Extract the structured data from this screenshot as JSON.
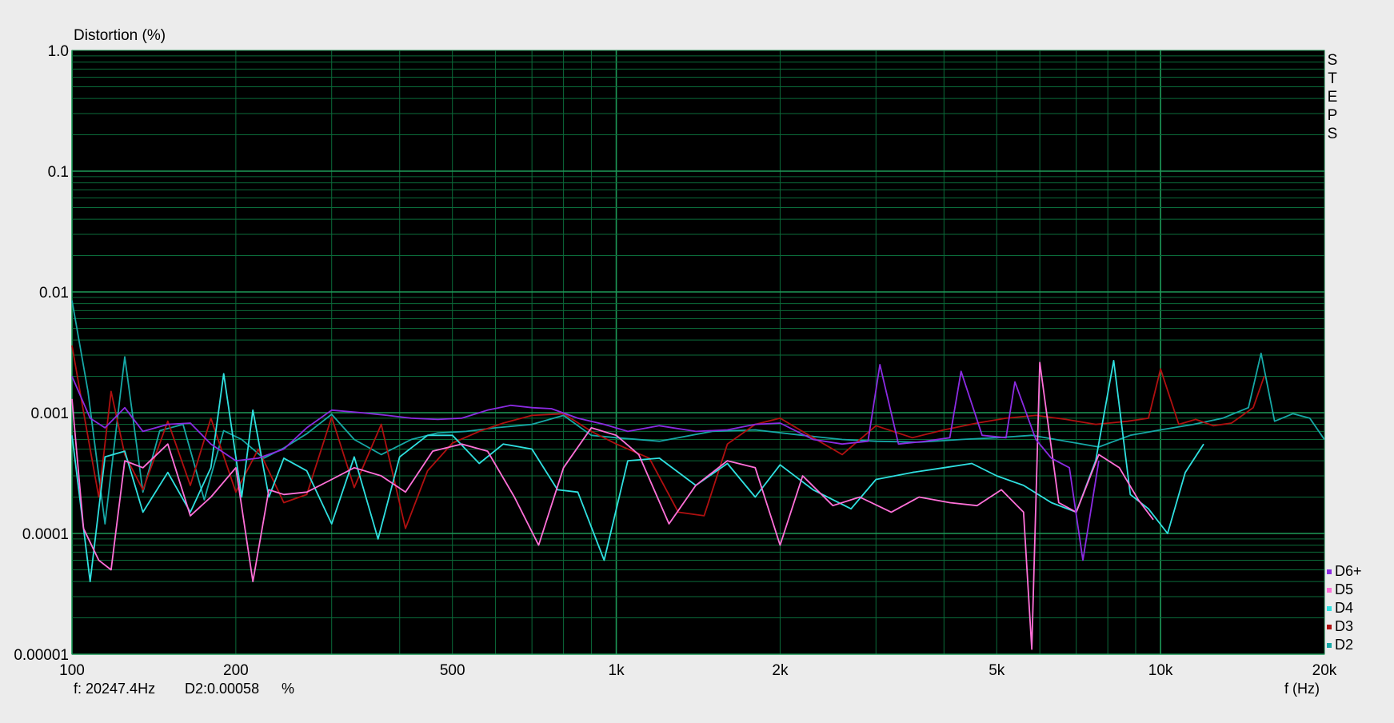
{
  "chart_data": {
    "type": "line",
    "ylabel": "Distortion (%)",
    "xlabel": "f (Hz)",
    "side_label": "STEPS",
    "xscale": "log",
    "yscale": "log",
    "xlim": [
      100,
      20000
    ],
    "ylim": [
      1e-05,
      1.0
    ],
    "grid": true,
    "legend_position": "bottom-right",
    "background": "#000000",
    "grid_color": "#0b6b3a",
    "x_ticks": [
      {
        "value": 100,
        "label": "100"
      },
      {
        "value": 200,
        "label": "200"
      },
      {
        "value": 500,
        "label": "500"
      },
      {
        "value": 1000,
        "label": "1k"
      },
      {
        "value": 2000,
        "label": "2k"
      },
      {
        "value": 5000,
        "label": "5k"
      },
      {
        "value": 10000,
        "label": "10k"
      },
      {
        "value": 20000,
        "label": "20k"
      }
    ],
    "y_ticks": [
      {
        "value": 1.0,
        "label": "1.0"
      },
      {
        "value": 0.1,
        "label": "0.1"
      },
      {
        "value": 0.01,
        "label": "0.01"
      },
      {
        "value": 0.001,
        "label": "0.001"
      },
      {
        "value": 0.0001,
        "label": "0.0001"
      },
      {
        "value": 1e-05,
        "label": "0.00001"
      }
    ],
    "series": [
      {
        "name": "D2",
        "color": "#16a8a6",
        "points": [
          [
            100,
            0.0085
          ],
          [
            107,
            0.0015
          ],
          [
            115,
            0.00012
          ],
          [
            125,
            0.0029
          ],
          [
            135,
            0.00022
          ],
          [
            145,
            0.00071
          ],
          [
            160,
            0.0008
          ],
          [
            175,
            0.00019
          ],
          [
            190,
            0.00071
          ],
          [
            205,
            0.0006
          ],
          [
            225,
            0.00042
          ],
          [
            245,
            0.00051
          ],
          [
            270,
            0.00067
          ],
          [
            300,
            0.00097
          ],
          [
            330,
            0.0006
          ],
          [
            370,
            0.00045
          ],
          [
            420,
            0.0006
          ],
          [
            470,
            0.00068
          ],
          [
            530,
            0.0007
          ],
          [
            600,
            0.00075
          ],
          [
            700,
            0.0008
          ],
          [
            800,
            0.00095
          ],
          [
            900,
            0.00065
          ],
          [
            1000,
            0.00062
          ],
          [
            1200,
            0.00058
          ],
          [
            1500,
            0.0007
          ],
          [
            1800,
            0.00072
          ],
          [
            2200,
            0.00065
          ],
          [
            2600,
            0.0006
          ],
          [
            3000,
            0.00058
          ],
          [
            3600,
            0.00057
          ],
          [
            4300,
            0.0006
          ],
          [
            5000,
            0.00062
          ],
          [
            5800,
            0.00065
          ],
          [
            6700,
            0.00058
          ],
          [
            7700,
            0.00052
          ],
          [
            8800,
            0.00065
          ],
          [
            10000,
            0.00072
          ],
          [
            11500,
            0.0008
          ],
          [
            13000,
            0.0009
          ],
          [
            14500,
            0.0011
          ],
          [
            15300,
            0.0031
          ],
          [
            16200,
            0.00085
          ],
          [
            17500,
            0.00098
          ],
          [
            18800,
            0.0009
          ],
          [
            20000,
            0.0006
          ]
        ]
      },
      {
        "name": "D3",
        "color": "#b01010",
        "points": [
          [
            100,
            0.0036
          ],
          [
            106,
            0.0008
          ],
          [
            112,
            0.0002
          ],
          [
            118,
            0.0015
          ],
          [
            125,
            0.00045
          ],
          [
            135,
            0.00023
          ],
          [
            150,
            0.00085
          ],
          [
            165,
            0.00025
          ],
          [
            180,
            0.0009
          ],
          [
            200,
            0.00022
          ],
          [
            220,
            0.0005
          ],
          [
            245,
            0.00018
          ],
          [
            270,
            0.00021
          ],
          [
            300,
            0.00092
          ],
          [
            330,
            0.00024
          ],
          [
            370,
            0.0008
          ],
          [
            410,
            0.00011
          ],
          [
            450,
            0.00033
          ],
          [
            500,
            0.00056
          ],
          [
            560,
            0.0007
          ],
          [
            620,
            0.00082
          ],
          [
            700,
            0.00095
          ],
          [
            800,
            0.00098
          ],
          [
            900,
            0.0007
          ],
          [
            1000,
            0.00055
          ],
          [
            1150,
            0.00042
          ],
          [
            1300,
            0.00015
          ],
          [
            1450,
            0.00014
          ],
          [
            1600,
            0.00055
          ],
          [
            1800,
            0.0008
          ],
          [
            2000,
            0.0009
          ],
          [
            2300,
            0.00062
          ],
          [
            2600,
            0.00045
          ],
          [
            3000,
            0.00078
          ],
          [
            3500,
            0.00062
          ],
          [
            4000,
            0.00072
          ],
          [
            4600,
            0.00082
          ],
          [
            5200,
            0.0009
          ],
          [
            5900,
            0.00095
          ],
          [
            6700,
            0.00088
          ],
          [
            7600,
            0.0008
          ],
          [
            8700,
            0.00085
          ],
          [
            9500,
            0.0009
          ],
          [
            10000,
            0.0023
          ],
          [
            10800,
            0.0008
          ],
          [
            11600,
            0.00088
          ],
          [
            12500,
            0.00078
          ],
          [
            13500,
            0.00082
          ],
          [
            14800,
            0.0011
          ],
          [
            15500,
            0.002
          ]
        ]
      },
      {
        "name": "D4",
        "color": "#2fe0e0",
        "points": [
          [
            100,
            0.00065
          ],
          [
            108,
            4e-05
          ],
          [
            115,
            0.00043
          ],
          [
            125,
            0.00048
          ],
          [
            135,
            0.00015
          ],
          [
            150,
            0.00032
          ],
          [
            165,
            0.00015
          ],
          [
            180,
            0.00035
          ],
          [
            190,
            0.0021
          ],
          [
            205,
            0.0002
          ],
          [
            215,
            0.00105
          ],
          [
            230,
            0.0002
          ],
          [
            245,
            0.00042
          ],
          [
            270,
            0.00033
          ],
          [
            300,
            0.00012
          ],
          [
            330,
            0.00043
          ],
          [
            365,
            9e-05
          ],
          [
            400,
            0.00043
          ],
          [
            450,
            0.00065
          ],
          [
            500,
            0.00065
          ],
          [
            560,
            0.00038
          ],
          [
            620,
            0.00055
          ],
          [
            700,
            0.0005
          ],
          [
            780,
            0.00023
          ],
          [
            850,
            0.00022
          ],
          [
            950,
            6e-05
          ],
          [
            1050,
            0.0004
          ],
          [
            1200,
            0.00042
          ],
          [
            1400,
            0.00025
          ],
          [
            1600,
            0.00038
          ],
          [
            1800,
            0.0002
          ],
          [
            2000,
            0.00037
          ],
          [
            2300,
            0.00023
          ],
          [
            2700,
            0.00016
          ],
          [
            3000,
            0.00028
          ],
          [
            3500,
            0.00032
          ],
          [
            4000,
            0.00035
          ],
          [
            4500,
            0.00038
          ],
          [
            5000,
            0.0003
          ],
          [
            5600,
            0.00025
          ],
          [
            6300,
            0.00018
          ],
          [
            7000,
            0.00015
          ],
          [
            7600,
            0.0004
          ],
          [
            8200,
            0.0027
          ],
          [
            8800,
            0.00021
          ],
          [
            9500,
            0.00016
          ],
          [
            10300,
            0.0001
          ],
          [
            11100,
            0.00032
          ],
          [
            12000,
            0.00055
          ]
        ]
      },
      {
        "name": "D5",
        "color": "#ff70d8",
        "points": [
          [
            100,
            0.0013
          ],
          [
            105,
            0.00011
          ],
          [
            112,
            6e-05
          ],
          [
            118,
            5e-05
          ],
          [
            125,
            0.0004
          ],
          [
            135,
            0.00035
          ],
          [
            150,
            0.00055
          ],
          [
            165,
            0.00014
          ],
          [
            180,
            0.0002
          ],
          [
            200,
            0.00035
          ],
          [
            215,
            4e-05
          ],
          [
            230,
            0.00023
          ],
          [
            245,
            0.00021
          ],
          [
            270,
            0.00022
          ],
          [
            300,
            0.00028
          ],
          [
            330,
            0.00035
          ],
          [
            370,
            0.0003
          ],
          [
            410,
            0.00022
          ],
          [
            460,
            0.00048
          ],
          [
            520,
            0.00055
          ],
          [
            580,
            0.00048
          ],
          [
            650,
            0.0002
          ],
          [
            720,
            8e-05
          ],
          [
            800,
            0.00035
          ],
          [
            900,
            0.00075
          ],
          [
            1000,
            0.00065
          ],
          [
            1100,
            0.00045
          ],
          [
            1250,
            0.00012
          ],
          [
            1400,
            0.00025
          ],
          [
            1600,
            0.0004
          ],
          [
            1800,
            0.00035
          ],
          [
            2000,
            8e-05
          ],
          [
            2200,
            0.0003
          ],
          [
            2500,
            0.00017
          ],
          [
            2800,
            0.0002
          ],
          [
            3200,
            0.00015
          ],
          [
            3600,
            0.0002
          ],
          [
            4100,
            0.00018
          ],
          [
            4600,
            0.00017
          ],
          [
            5100,
            0.00023
          ],
          [
            5600,
            0.00015
          ],
          [
            5800,
            1.1e-05
          ],
          [
            6000,
            0.0026
          ],
          [
            6500,
            0.00018
          ],
          [
            7000,
            0.00015
          ],
          [
            7700,
            0.00045
          ],
          [
            8400,
            0.00035
          ],
          [
            9100,
            0.00019
          ],
          [
            9700,
            0.00013
          ]
        ]
      },
      {
        "name": "D6+",
        "color": "#8b2be2",
        "points": [
          [
            100,
            0.002
          ],
          [
            108,
            0.0009
          ],
          [
            115,
            0.00075
          ],
          [
            125,
            0.0011
          ],
          [
            135,
            0.0007
          ],
          [
            150,
            0.0008
          ],
          [
            165,
            0.00082
          ],
          [
            180,
            0.00055
          ],
          [
            200,
            0.0004
          ],
          [
            220,
            0.00042
          ],
          [
            245,
            0.0005
          ],
          [
            270,
            0.00075
          ],
          [
            300,
            0.00105
          ],
          [
            340,
            0.001
          ],
          [
            380,
            0.00095
          ],
          [
            420,
            0.0009
          ],
          [
            470,
            0.00088
          ],
          [
            520,
            0.0009
          ],
          [
            580,
            0.00105
          ],
          [
            640,
            0.00115
          ],
          [
            700,
            0.0011
          ],
          [
            760,
            0.00108
          ],
          [
            850,
            0.0009
          ],
          [
            950,
            0.0008
          ],
          [
            1050,
            0.0007
          ],
          [
            1200,
            0.00078
          ],
          [
            1400,
            0.0007
          ],
          [
            1600,
            0.00072
          ],
          [
            1800,
            0.0008
          ],
          [
            2000,
            0.00082
          ],
          [
            2300,
            0.0006
          ],
          [
            2600,
            0.00055
          ],
          [
            2900,
            0.00058
          ],
          [
            3050,
            0.0025
          ],
          [
            3300,
            0.00055
          ],
          [
            3700,
            0.00058
          ],
          [
            4100,
            0.00062
          ],
          [
            4300,
            0.0022
          ],
          [
            4700,
            0.00065
          ],
          [
            5200,
            0.00062
          ],
          [
            5400,
            0.0018
          ],
          [
            5900,
            0.0006
          ],
          [
            6300,
            0.00042
          ],
          [
            6800,
            0.00035
          ],
          [
            7200,
            6e-05
          ],
          [
            7700,
            0.0004
          ]
        ]
      }
    ],
    "legend_order": [
      "D6+",
      "D5",
      "D4",
      "D3",
      "D2"
    ]
  },
  "readout": {
    "frequency": "f: 20247.4Hz",
    "value": "D2:0.00058",
    "unit": "%"
  }
}
